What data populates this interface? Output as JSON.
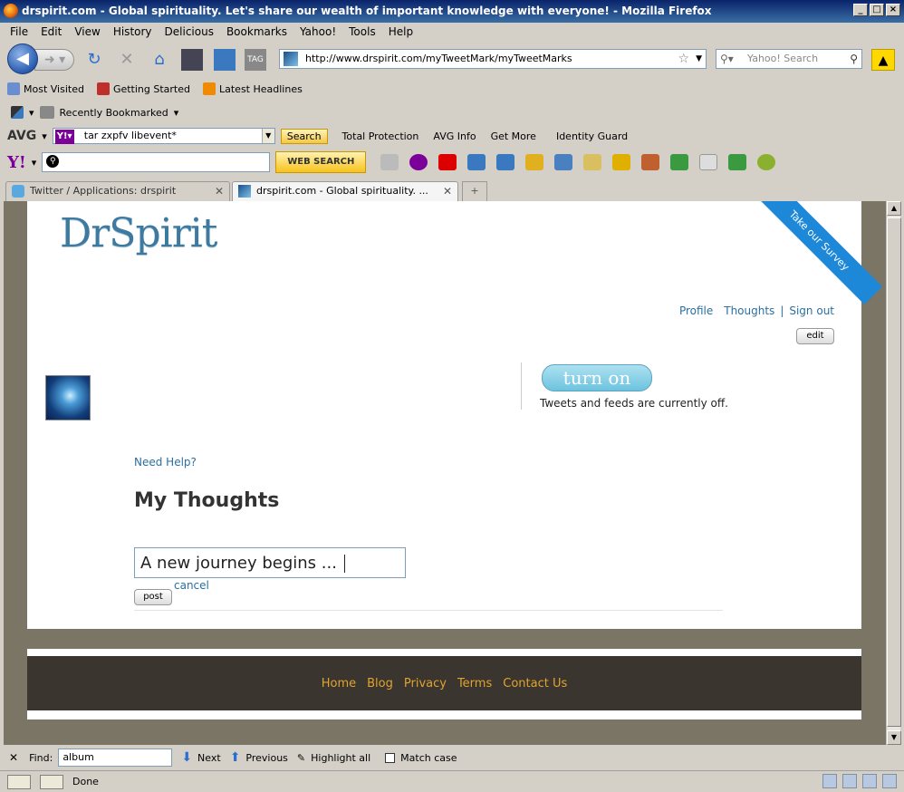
{
  "window": {
    "title": "drspirit.com - Global spirituality. Let's share our wealth of important knowledge with everyone! - Mozilla Firefox",
    "minimize": "_",
    "maximize": "□",
    "close": "×"
  },
  "menu": [
    "File",
    "Edit",
    "View",
    "History",
    "Delicious",
    "Bookmarks",
    "Yahoo!",
    "Tools",
    "Help"
  ],
  "navigation": {
    "url": "http://www.drspirit.com/myTweetMark/myTweetMarks",
    "search_placeholder": "Yahoo! Search"
  },
  "bookmarks": [
    "Most Visited",
    "Getting Started",
    "Latest Headlines"
  ],
  "recent": {
    "label": "Recently Bookmarked"
  },
  "avg": {
    "logo": "AVG",
    "query": "tar zxpfv libevent*",
    "search_label": "Search",
    "items": [
      "Total Protection",
      "AVG Info",
      "Get More",
      "Identity Guard"
    ]
  },
  "yahoo": {
    "logo": "Y!",
    "web_search": "WEB SEARCH"
  },
  "tabs": [
    {
      "label": "Twitter / Applications: drspirit",
      "active": false
    },
    {
      "label": "drspirit.com - Global spirituality. ...",
      "active": true
    }
  ],
  "page": {
    "logo": "DrSpirit",
    "survey": "Take our Survey",
    "links": {
      "profile": "Profile",
      "thoughts": "Thoughts",
      "signout": "Sign out"
    },
    "edit": "edit",
    "turn_on": "turn on",
    "feeds_status": "Tweets and feeds are currently off.",
    "help": "Need Help?",
    "heading": "My Thoughts",
    "thought_value": "A new journey begins ...",
    "post": "post",
    "cancel": "cancel",
    "footer_links": [
      "Home",
      "Blog",
      "Privacy",
      "Terms",
      "Contact Us"
    ]
  },
  "find": {
    "label": "Find:",
    "value": "album",
    "next": "Next",
    "previous": "Previous",
    "highlight": "Highlight all",
    "match_case": "Match case"
  },
  "status": {
    "text": "Done"
  },
  "colors": {
    "logo": "#3e7aa0",
    "link": "#2a6fa0",
    "footer_bg": "#3a352f",
    "footer_link": "#e0a430",
    "page_bg": "#7a7565"
  }
}
